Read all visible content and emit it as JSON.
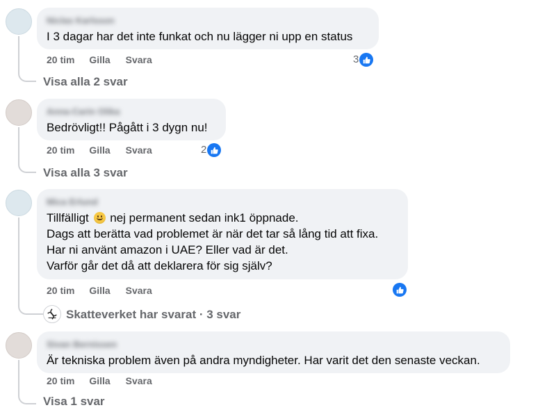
{
  "colors": {
    "bubble_bg": "#f0f2f5",
    "meta_text": "#65676b",
    "like_blue": "#1877f2",
    "thread_line": "#ced0d4"
  },
  "comments": [
    {
      "author": "Niclas Karlsson",
      "lines": [
        "I 3 dagar har det inte funkat och nu lägger ni upp en status"
      ],
      "time": "20 tim",
      "like_label": "Gilla",
      "reply_label": "Svara",
      "reaction_count": "3",
      "reaction_icon": "like-icon",
      "replies_link": "Visa alla 2 svar"
    },
    {
      "author": "Anna-Carin Olika",
      "lines": [
        "Bedrövligt!! Pågått i 3 dygn nu!"
      ],
      "time": "20 tim",
      "like_label": "Gilla",
      "reply_label": "Svara",
      "reaction_count": "2",
      "reaction_icon": "like-icon",
      "replies_link": "Visa alla 3 svar"
    },
    {
      "author": "Mica Erlund",
      "lines": [
        "Tillfälligt",
        "nej permanent sedan ink1 öppnade.",
        "Dags att berätta vad problemet är när det tar så lång tid att fixa.",
        "Har ni använt amazon i UAE? Eller vad är det.",
        "Varför går det då att deklarera för sig själv?"
      ],
      "emoji": "smiling-face-emoji",
      "time": "20 tim",
      "like_label": "Gilla",
      "reply_label": "Svara",
      "reaction_count": "",
      "reaction_icon": "like-icon",
      "page_reply_logo": "skatteverket-logo-icon",
      "page_replies_link": "Skatteverket har svarat · 3 svar"
    },
    {
      "author": "Sivan Bernissen",
      "lines": [
        "Är tekniska problem även på andra myndigheter. Har varit det den senaste veckan."
      ],
      "time": "20 tim",
      "like_label": "Gilla",
      "reply_label": "Svara",
      "replies_link": "Visa 1 svar"
    }
  ]
}
